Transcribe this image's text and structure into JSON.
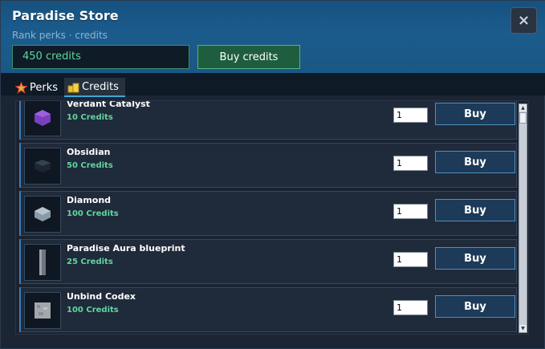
{
  "window": {
    "title": "Paradise Store",
    "subtitle": "Rank perks · credits",
    "close_label": "×"
  },
  "balance": {
    "value": "450 credits",
    "buy_label": "Buy credits"
  },
  "tabs": [
    {
      "label": "Perks",
      "icon": "star-icon",
      "active": false
    },
    {
      "label": "Credits",
      "icon": "coins-icon",
      "active": true
    }
  ],
  "items": [
    {
      "name": "Verdant Catalyst",
      "price": "10 Credits",
      "qty": "1",
      "buy_label": "Buy",
      "icon": "purple-gem-icon",
      "color": "#7a3fbf"
    },
    {
      "name": "Obsidian",
      "price": "50 Credits",
      "qty": "1",
      "buy_label": "Buy",
      "icon": "obsidian-block-icon",
      "color": "#1c2530"
    },
    {
      "name": "Diamond",
      "price": "100 Credits",
      "qty": "1",
      "buy_label": "Buy",
      "icon": "diamond-block-icon",
      "color": "#8b9aa8"
    },
    {
      "name": "Paradise Aura blueprint",
      "price": "25 Credits",
      "qty": "1",
      "buy_label": "Buy",
      "icon": "blueprint-pillar-icon",
      "color": "#6d7680"
    },
    {
      "name": "Unbind Codex",
      "price": "100 Credits",
      "qty": "1",
      "buy_label": "Buy",
      "icon": "codex-block-icon",
      "color": "#a3a8ad"
    }
  ],
  "colors": {
    "accent_green": "#5fd6a0",
    "accent_blue": "#3fa7d6",
    "header_blue": "#1b5c8c"
  }
}
